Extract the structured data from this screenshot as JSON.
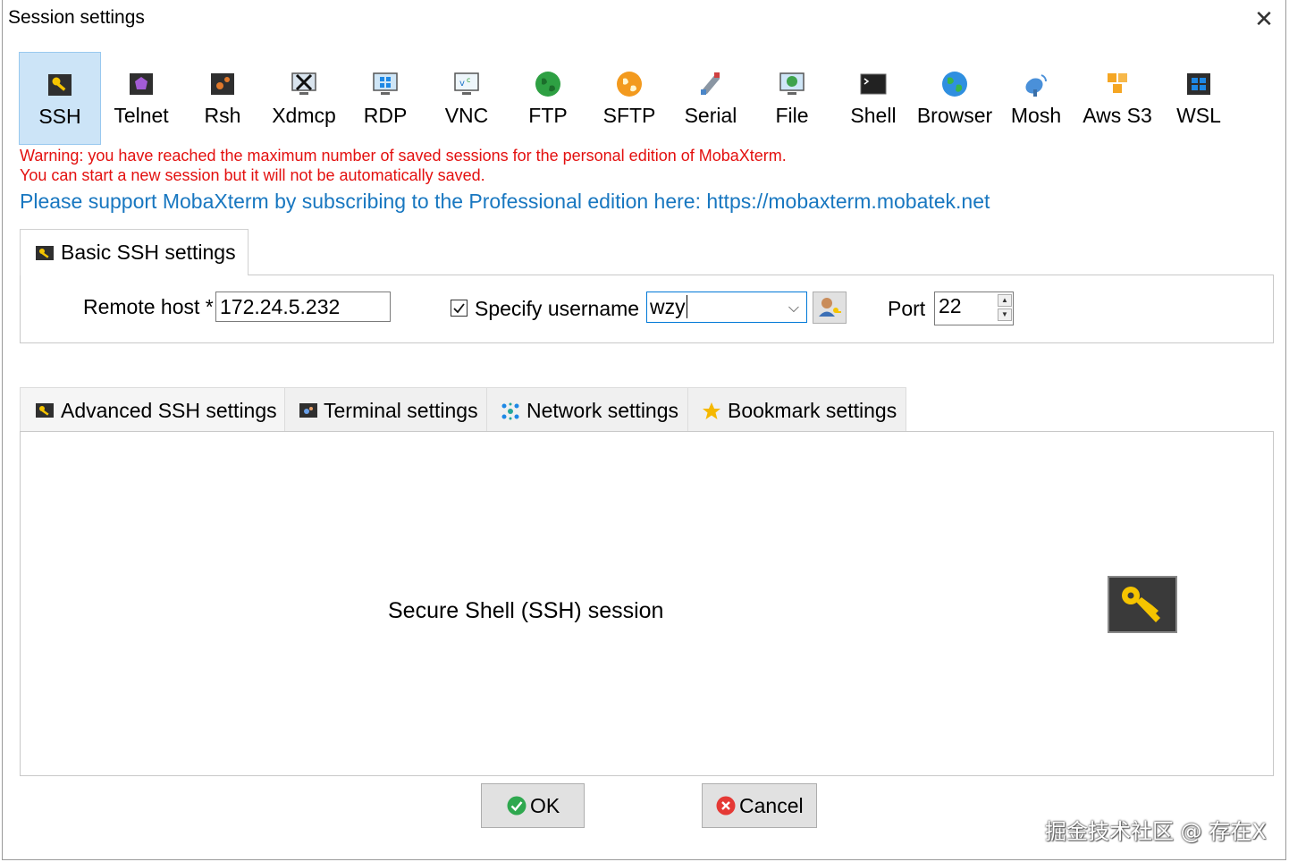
{
  "window": {
    "title": "Session settings",
    "close_glyph": "✕"
  },
  "session_types": [
    {
      "label": "SSH",
      "icon": "ssh-key-icon",
      "active": true
    },
    {
      "label": "Telnet",
      "icon": "telnet-icon"
    },
    {
      "label": "Rsh",
      "icon": "rsh-icon"
    },
    {
      "label": "Xdmcp",
      "icon": "xdmcp-icon"
    },
    {
      "label": "RDP",
      "icon": "rdp-icon"
    },
    {
      "label": "VNC",
      "icon": "vnc-icon"
    },
    {
      "label": "FTP",
      "icon": "ftp-globe-icon"
    },
    {
      "label": "SFTP",
      "icon": "sftp-globe-icon"
    },
    {
      "label": "Serial",
      "icon": "serial-plug-icon"
    },
    {
      "label": "File",
      "icon": "file-monitor-icon"
    },
    {
      "label": "Shell",
      "icon": "shell-terminal-icon"
    },
    {
      "label": "Browser",
      "icon": "browser-globe-icon"
    },
    {
      "label": "Mosh",
      "icon": "mosh-satellite-icon"
    },
    {
      "label": "Aws S3",
      "icon": "aws-s3-cubes-icon"
    },
    {
      "label": "WSL",
      "icon": "wsl-windows-icon"
    }
  ],
  "warning": {
    "line1": "Warning: you have reached the maximum number of saved sessions for the personal edition of MobaXterm.",
    "line2": "You can start a new session but it will not be automatically saved."
  },
  "support_text": "Please support MobaXterm by subscribing to the Professional edition here: https://mobaxterm.mobatek.net",
  "basic": {
    "tab_label": "Basic SSH settings",
    "remote_host_label": "Remote host *",
    "remote_host_value": "172.24.5.232",
    "specify_username_label": "Specify username",
    "specify_username_checked": true,
    "username_value": "wzy",
    "port_label": "Port",
    "port_value": "22"
  },
  "advanced_tabs": [
    {
      "label": "Advanced SSH settings",
      "icon": "ssh-key-icon"
    },
    {
      "label": "Terminal settings",
      "icon": "terminal-icon"
    },
    {
      "label": "Network settings",
      "icon": "network-icon"
    },
    {
      "label": "Bookmark settings",
      "icon": "star-icon"
    }
  ],
  "panel": {
    "description": "Secure Shell (SSH) session"
  },
  "buttons": {
    "ok": "OK",
    "cancel": "Cancel"
  },
  "watermark": "掘金技术社区 @ 存在X",
  "colors": {
    "warning": "#e3100f",
    "link": "#1877c0",
    "selected_bg": "#cce4f7",
    "key_yellow": "#f5c400"
  }
}
